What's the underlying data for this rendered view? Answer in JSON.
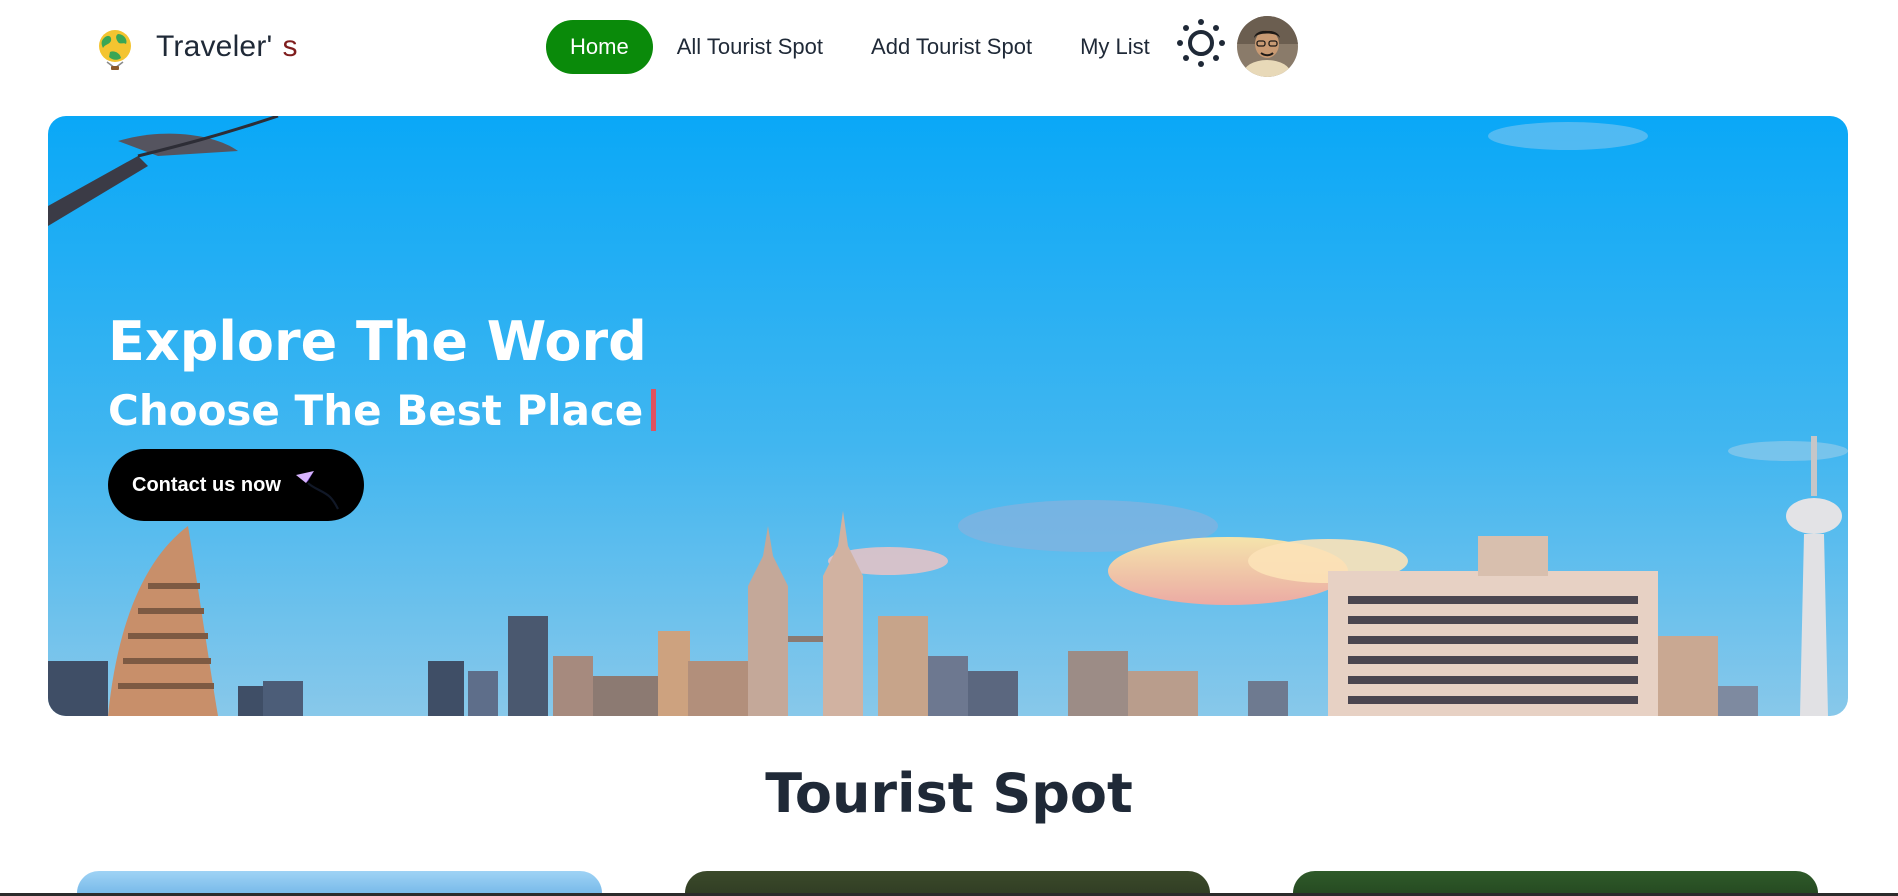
{
  "navbar": {
    "logo_icon": "globe-balloon-icon",
    "brand_main": "Traveler'",
    "brand_accent": "s",
    "links": [
      {
        "label": "Home",
        "active": true
      },
      {
        "label": "All Tourist Spot",
        "active": false
      },
      {
        "label": "Add Tourist Spot",
        "active": false
      },
      {
        "label": "My List",
        "active": false
      }
    ],
    "theme_icon": "sun-icon",
    "avatar_icon": "user-avatar"
  },
  "hero": {
    "title": "Explore The Word",
    "subtitle": "Choose The Best Place",
    "cta_label": "Contact us now",
    "cta_icon": "paper-plane-icon"
  },
  "section": {
    "title": "Tourist Spot"
  },
  "colors": {
    "active_nav": "#0a8a0a",
    "brand_accent": "#7f1d1d",
    "cta_bg": "#000000",
    "typing_cursor": "#e05260"
  }
}
